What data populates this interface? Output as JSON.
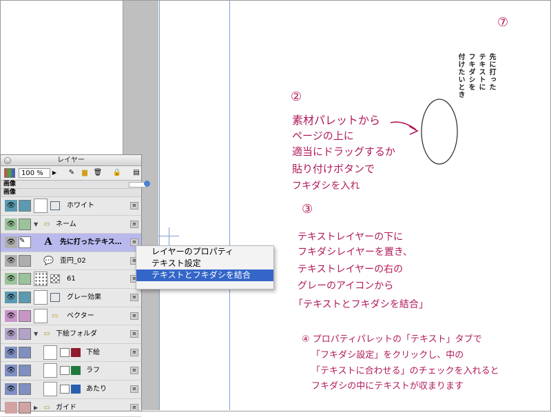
{
  "palette": {
    "title": "レイヤー",
    "zoom": "100 %",
    "header_group": "画像",
    "sub_group": "画像",
    "layers": [
      {
        "name": "ホワイト",
        "eye_color": "#5b9ab0",
        "lock_color": "#5b9ab0"
      },
      {
        "name": "ネーム",
        "eye_color": "#9bc39b",
        "lock_color": "#9bc39b"
      },
      {
        "name": "先に打ったテキス…",
        "eye_color": "#aeaeae",
        "lock_color": "#aeaeae",
        "selected": true
      },
      {
        "name": "歪円_02",
        "eye_color": "#aeaeae",
        "lock_color": "#aeaeae"
      },
      {
        "name": "61",
        "eye_color": "#9bc39b",
        "lock_color": "#9bc39b"
      },
      {
        "name": "グレー効果",
        "eye_color": "#5b9ab0",
        "lock_color": "#5b9ab0"
      },
      {
        "name": "ベクター",
        "eye_color": "#c895c8",
        "lock_color": "#c895c8"
      },
      {
        "name": "下絵フォルダ",
        "eye_color": "#b3a3c8",
        "lock_color": "#b3a3c8"
      },
      {
        "name": "下絵",
        "eye_color": "#7f8fc0",
        "lock_color": "#7f8fc0"
      },
      {
        "name": "ラフ",
        "eye_color": "#7f8fc0",
        "lock_color": "#7f8fc0"
      },
      {
        "name": "あたり",
        "eye_color": "#7f8fc0",
        "lock_color": "#7f8fc0"
      },
      {
        "name": "ガイド",
        "eye_color": "#d1a3a3",
        "lock_color": "#d1a3a3"
      }
    ]
  },
  "context_menu": {
    "items": [
      "レイヤーのプロパティ",
      "テキスト設定",
      "テキストとフキダシを結合"
    ]
  },
  "vertical_text": [
    "先に打った",
    "テキストに",
    "フキダシを",
    "付けたいとき"
  ],
  "annotations": {
    "step7": "⑦",
    "step2": "②",
    "step2_lines": [
      "素材パレットから",
      "ページの上に",
      "適当にドラッグするか",
      "貼り付けボタンで",
      "フキダシを入れ"
    ],
    "step3": "③",
    "step3_lines": [
      "テキストレイヤーの下に",
      "フキダシレイヤーを置き、",
      "テキストレイヤーの右の",
      "グレーのアイコンから",
      "「テキストとフキダシを結合」"
    ],
    "step4_lines": [
      "④ プロパティパレットの「テキスト」タブで",
      "「フキダシ設定」をクリックし、中の",
      "「テキストに合わせる」のチェックを入れると",
      "フキダシの中にテキストが収まります"
    ]
  }
}
